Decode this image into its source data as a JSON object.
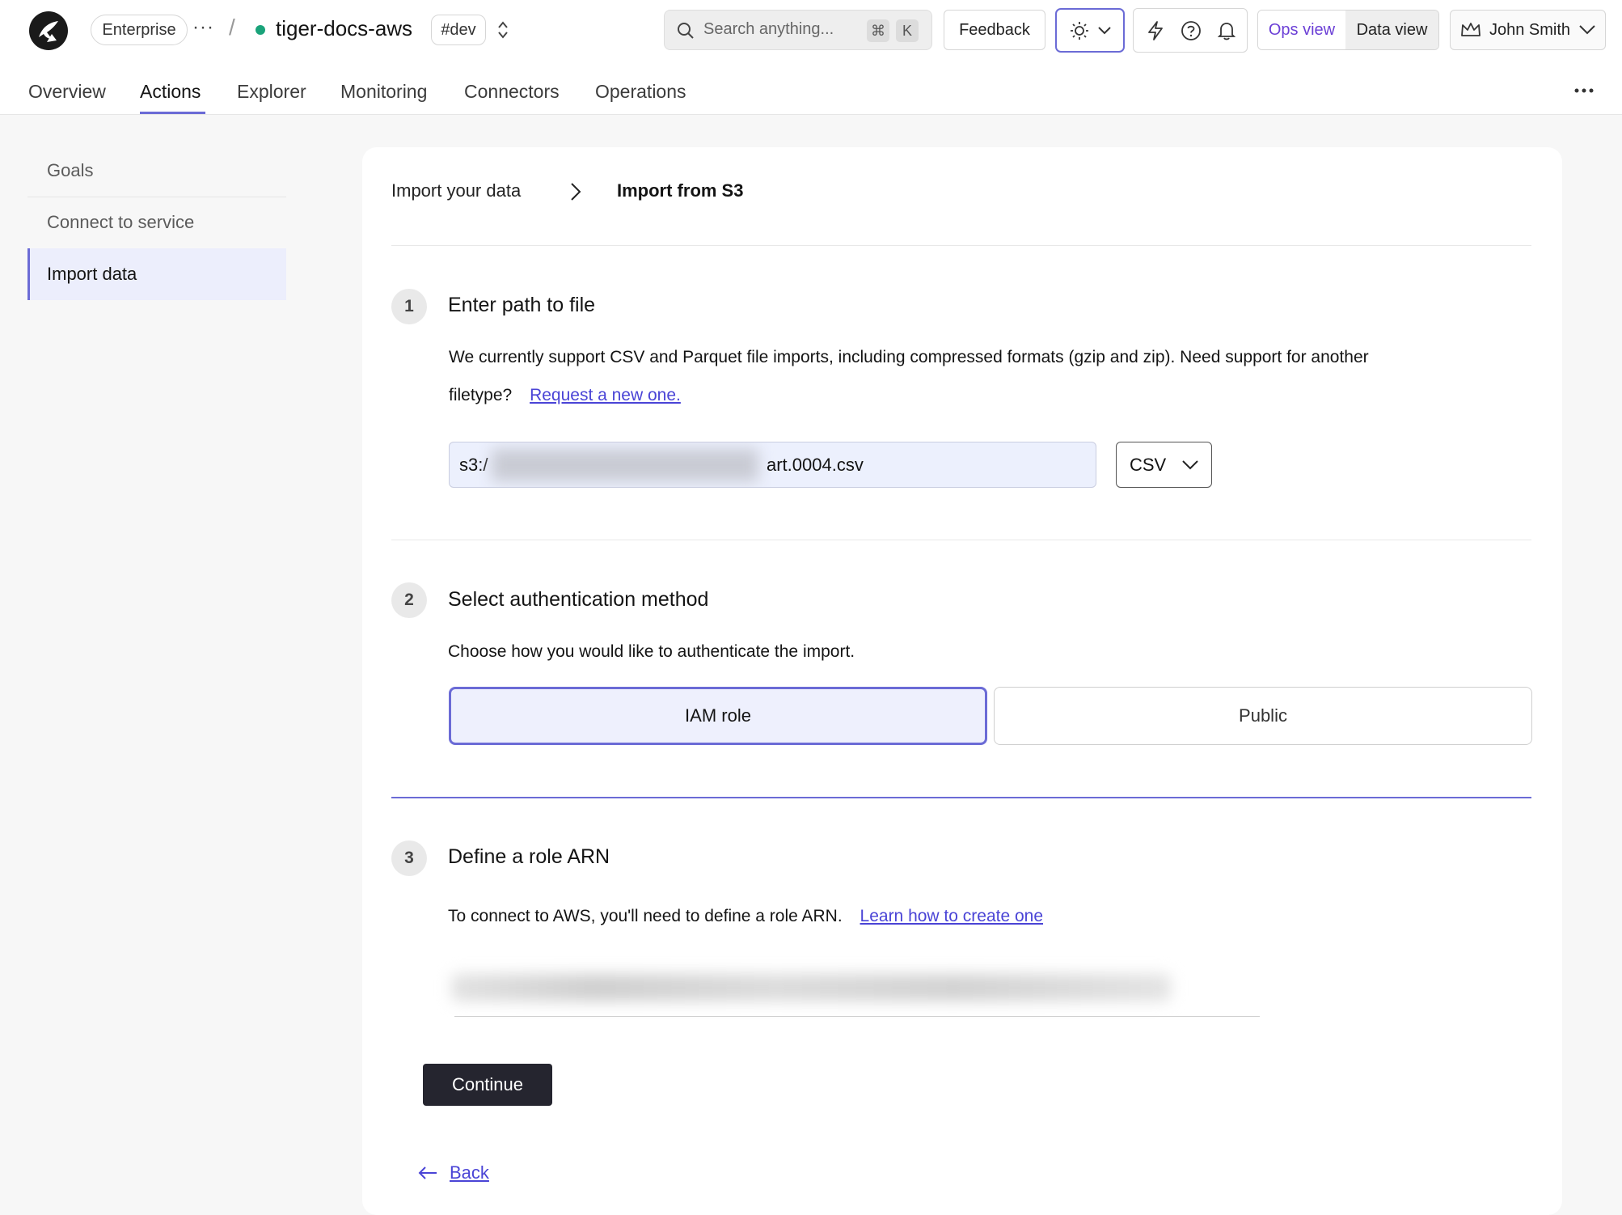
{
  "header": {
    "org": "Enterprise",
    "more": "···",
    "slash": "/",
    "project": "tiger-docs-aws",
    "env": "#dev",
    "search_placeholder": "Search anything...",
    "shortcut_cmd": "⌘",
    "shortcut_key": "K",
    "feedback": "Feedback",
    "ops_view": "Ops view",
    "data_view": "Data view",
    "user": "John Smith",
    "status_color": "#1aa37a",
    "accent": "#6b6bd6"
  },
  "tabs": [
    "Overview",
    "Actions",
    "Explorer",
    "Monitoring",
    "Connectors",
    "Operations"
  ],
  "sidebar": {
    "items": [
      {
        "label": "Goals"
      },
      {
        "label": "Connect to service"
      },
      {
        "label": "Import data"
      }
    ]
  },
  "breadcrumb": {
    "parent": "Import your data",
    "current": "Import from S3"
  },
  "step1": {
    "num": "1",
    "title": "Enter path to file",
    "text": "We currently support CSV and Parquet file imports, including compressed formats (gzip and zip). Need support for another",
    "text2": "filetype?",
    "link": "Request a new one.",
    "path_prefix": "s3:/",
    "path_suffix": "art.0004.csv",
    "format": "CSV"
  },
  "step2": {
    "num": "2",
    "title": "Select authentication method",
    "text": "Choose how you would like to authenticate the import.",
    "option_iam": "IAM role",
    "option_public": "Public"
  },
  "step3": {
    "num": "3",
    "title": "Define a role ARN",
    "text": "To connect to AWS, you'll need to define a role ARN.",
    "link": "Learn how to create one"
  },
  "actions": {
    "continue": "Continue",
    "back": "Back"
  }
}
